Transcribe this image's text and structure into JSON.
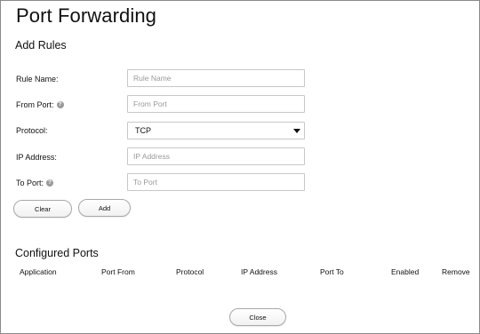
{
  "page": {
    "title": "Port Forwarding"
  },
  "add_rules": {
    "title": "Add Rules",
    "rule_name": {
      "label": "Rule Name:",
      "value": "",
      "placeholder": "Rule Name"
    },
    "from_port": {
      "label": "From Port:",
      "value": "",
      "placeholder": "From Port",
      "help_icon": "question-icon"
    },
    "protocol": {
      "label": "Protocol:",
      "selected": "TCP"
    },
    "ip_address": {
      "label": "IP Address:",
      "value": "",
      "placeholder": "IP Address"
    },
    "to_port": {
      "label": "To Port:",
      "value": "",
      "placeholder": "To Port",
      "help_icon": "question-icon"
    },
    "help_glyph": "?",
    "clear_label": "Clear",
    "add_label": "Add"
  },
  "configured_ports": {
    "title": "Configured Ports",
    "columns": [
      "Application",
      "Port From",
      "Protocol",
      "IP Address",
      "Port To",
      "Enabled",
      "Remove"
    ],
    "rows": []
  },
  "footer": {
    "close_label": "Close"
  }
}
